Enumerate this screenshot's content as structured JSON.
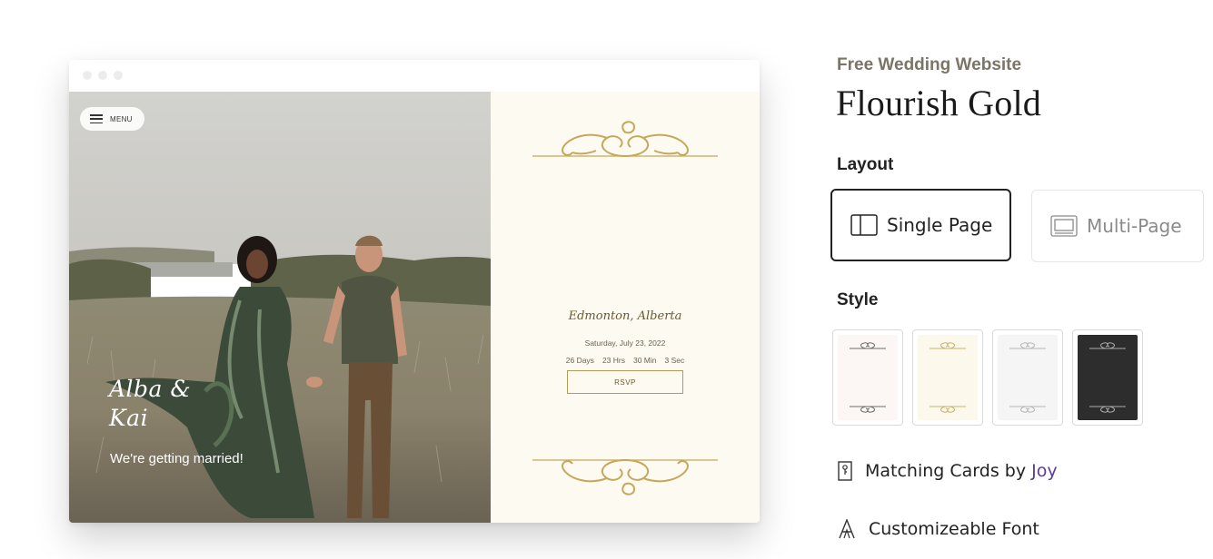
{
  "preview": {
    "menu_label": "MENU",
    "couple_names": "Alba &\nKai",
    "tagline": "We're getting married!",
    "location": "Edmonton, Alberta",
    "date": "Saturday, July 23, 2022",
    "countdown": [
      "26 Days",
      "23 Hrs",
      "30 Min",
      "3 Sec"
    ],
    "rsvp_label": "RSVP"
  },
  "details": {
    "eyebrow": "Free Wedding Website",
    "title": "Flourish Gold",
    "layout_label": "Layout",
    "layout_options": [
      {
        "label": "Single Page",
        "selected": true,
        "icon": "single-page-icon"
      },
      {
        "label": "Multi-Page",
        "selected": false,
        "icon": "multi-page-icon"
      }
    ],
    "style_label": "Style",
    "styles": [
      {
        "name": "blush",
        "background": "#fcf7f4",
        "accent": "#6d6d6d"
      },
      {
        "name": "cream-gold",
        "background": "#fcf8ec",
        "accent": "#c9b36a"
      },
      {
        "name": "light-gray",
        "background": "#f5f5f5",
        "accent": "#b5b5b5"
      },
      {
        "name": "charcoal",
        "background": "#2d2d2d",
        "accent": "#aaaaaa"
      }
    ],
    "features": [
      {
        "icon": "card-icon",
        "text": "Matching Cards by ",
        "link": "Joy"
      },
      {
        "icon": "font-icon",
        "text": "Customizeable Font",
        "link": ""
      }
    ]
  },
  "colors": {
    "gold": "#b59a57",
    "panel_background": "#fdfaf1",
    "link": "#5a3b9c"
  }
}
